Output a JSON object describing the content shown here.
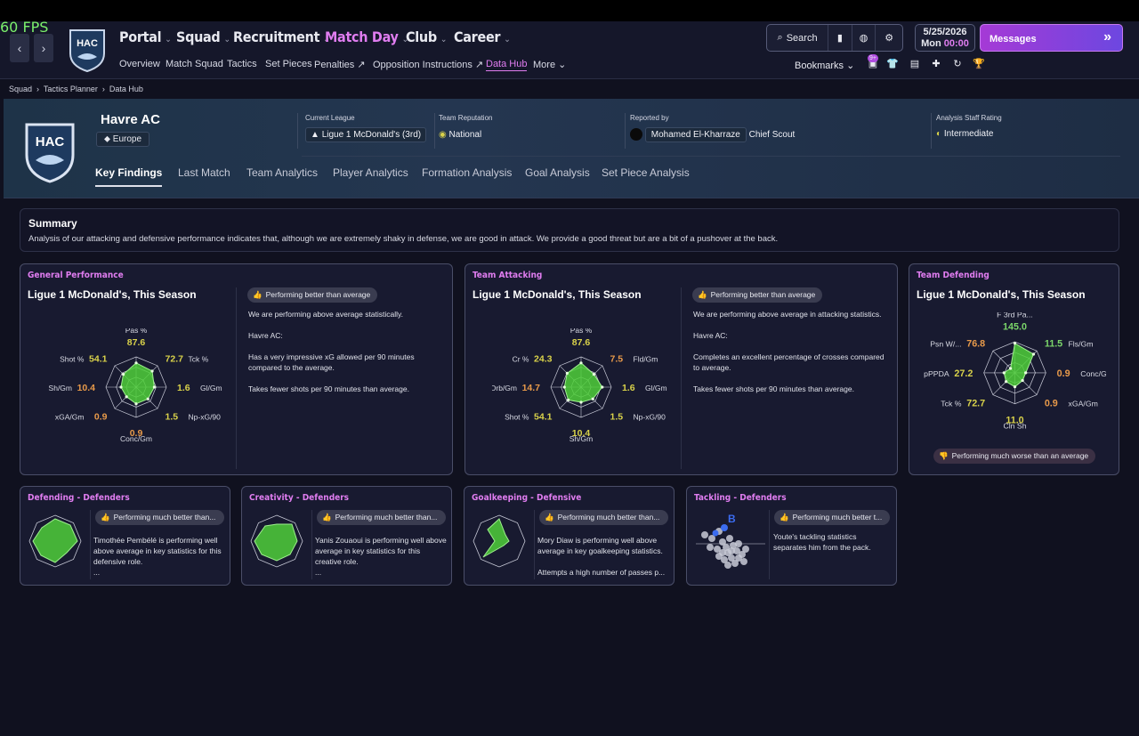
{
  "fps": "60 FPS",
  "nav": {
    "main": [
      {
        "label": "Portal"
      },
      {
        "label": "Squad"
      },
      {
        "label": "Recruitment"
      },
      {
        "label": "Match Day"
      },
      {
        "label": "Club"
      },
      {
        "label": "Career"
      }
    ],
    "sub": [
      "Overview",
      "Match Squad",
      "Tactics",
      "Set Pieces",
      "Penalties",
      "Opposition Instructions",
      "Data Hub",
      "More"
    ],
    "search_label": "Search",
    "date": "5/25/2026",
    "day": "Mon",
    "time": "00:00",
    "messages_label": "Messages",
    "bookmarks_label": "Bookmarks",
    "notif_badge": "9+"
  },
  "breadcrumb": [
    "Squad",
    "Tactics Planner",
    "Data Hub"
  ],
  "team": {
    "name": "Havre AC",
    "region": "Europe",
    "crest_text": "HAC",
    "league_label": "Current League",
    "league": "Ligue 1 McDonald's (3rd)",
    "rep_label": "Team Reputation",
    "rep": "National",
    "reported_label": "Reported by",
    "scout": "Mohamed El-Kharraze",
    "scout_role": "Chief Scout",
    "staff_label": "Analysis Staff Rating",
    "staff": "Intermediate"
  },
  "tabs": [
    "Key Findings",
    "Last Match",
    "Team Analytics",
    "Player Analytics",
    "Formation Analysis",
    "Goal Analysis",
    "Set Piece Analysis"
  ],
  "summary": {
    "title": "Summary",
    "text": "Analysis of our attacking and defensive performance indicates that, although we are extremely shaky in defense, we are good in attack. We provide a good threat but are a bit of a pushover at the back."
  },
  "cards": {
    "general": {
      "title": "General Performance",
      "subtitle": "Ligue 1 McDonald's, This Season",
      "pill": "Performing better than average",
      "p1": "We are performing above average statistically.",
      "p2": "Havre AC:",
      "p3": "Has a very impressive xG allowed per 90 minutes compared to the average.",
      "p4": "Takes fewer shots per 90 minutes than average."
    },
    "attacking": {
      "title": "Team Attacking",
      "subtitle": "Ligue 1 McDonald's, This Season",
      "pill": "Performing better than average",
      "p1": "We are performing above average in attacking statistics.",
      "p2": "Havre AC:",
      "p3": "Completes an excellent percentage of crosses compared to average.",
      "p4": "Takes fewer shots per 90 minutes than average."
    },
    "defending": {
      "title": "Team Defending",
      "subtitle": "Ligue 1 McDonald's, This Season",
      "pill": "Performing much worse than an average"
    },
    "def_defenders": {
      "title": "Defending - Defenders",
      "pill": "Performing much better than...",
      "desc": "Timothée Pembélé is performing well above average in key statistics for this defensive role.",
      "more": "..."
    },
    "creativity": {
      "title": "Creativity - Defenders",
      "pill": "Performing much better than...",
      "desc": "Yanis Zouaoui is performing well above average in key statistics for this creative role.",
      "more": "..."
    },
    "goalkeeping": {
      "title": "Goalkeeping - Defensive",
      "pill": "Performing much better than...",
      "desc": "Mory Diaw is performing well above average in key goalkeeping statistics.",
      "desc2": "Attempts a high number of passes p..."
    },
    "tackling": {
      "title": "Tackling - Defenders",
      "pill": "Performing much better t...",
      "desc": "Youte's tackling statistics separates him from the pack.",
      "marker": "B"
    }
  },
  "chart_data": [
    {
      "type": "radar",
      "name": "General Performance",
      "axes": [
        "Pas %",
        "Tck %",
        "Gl/Gm",
        "Np-xG/90",
        "Conc/Gm",
        "xGA/Gm",
        "Sh/Gm",
        "Shot %"
      ],
      "values": [
        "87.6",
        "72.7",
        "1.6",
        "1.5",
        "0.9",
        "0.9",
        "10.4",
        "54.1"
      ],
      "levels": [
        0.8,
        0.75,
        0.6,
        0.55,
        0.55,
        0.45,
        0.5,
        0.6
      ],
      "colors": [
        "#d9d24a",
        "#d9d24a",
        "#d9d24a",
        "#d9d24a",
        "#e89a4a",
        "#e89a4a",
        "#e89a4a",
        "#d9d24a"
      ]
    },
    {
      "type": "radar",
      "name": "Team Attacking",
      "axes": [
        "Pas %",
        "Fld/Gm",
        "Gl/Gm",
        "Np-xG/90",
        "Sh/Gm",
        "Shot %",
        "Drb/Gm",
        "Cr %"
      ],
      "values": [
        "87.6",
        "7.5",
        "1.6",
        "1.5",
        "10.4",
        "54.1",
        "14.7",
        "24.3"
      ],
      "levels": [
        0.8,
        0.6,
        0.7,
        0.55,
        0.5,
        0.6,
        0.55,
        0.65
      ],
      "colors": [
        "#d9d24a",
        "#e89a4a",
        "#d9d24a",
        "#d9d24a",
        "#d9d24a",
        "#d9d24a",
        "#e89a4a",
        "#d9d24a"
      ]
    },
    {
      "type": "radar",
      "name": "Team Defending",
      "axes": [
        "F 3rd Pa...",
        "Fls/Gm",
        "Conc/Gm",
        "xGA/Gm",
        "Cln Sh",
        "Tck %",
        "OpPPDA",
        "Psn W/..."
      ],
      "values": [
        "145.0",
        "11.5",
        "0.9",
        "0.9",
        "11.0",
        "72.7",
        "27.2",
        "76.8"
      ],
      "levels": [
        0.95,
        0.85,
        0.35,
        0.35,
        0.45,
        0.4,
        0.35,
        0.2
      ],
      "colors": [
        "#7bd66a",
        "#7bd66a",
        "#e89a4a",
        "#e89a4a",
        "#d9d24a",
        "#d9d24a",
        "#d9d24a",
        "#e89a4a"
      ]
    }
  ]
}
